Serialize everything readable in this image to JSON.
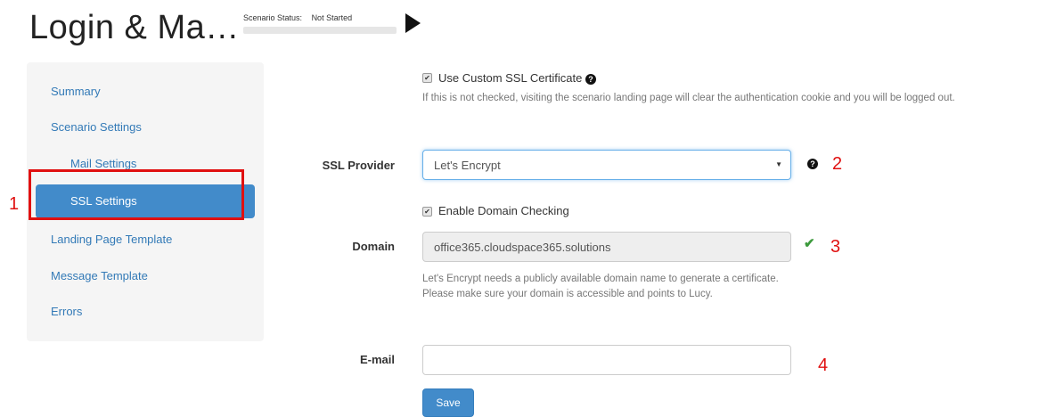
{
  "header": {
    "title": "Login & Ma…",
    "status_label": "Scenario Status:",
    "status_value": "Not Started",
    "play_icon": "play-icon"
  },
  "sidebar": {
    "items": [
      {
        "label": "Summary",
        "active": false
      },
      {
        "label": "Scenario Settings",
        "active": false
      },
      {
        "label": "Mail Settings",
        "active": false
      },
      {
        "label": "SSL Settings",
        "active": true
      },
      {
        "label": "Landing Page Template",
        "active": false
      },
      {
        "label": "Message Template",
        "active": false
      },
      {
        "label": "Errors",
        "active": false
      }
    ]
  },
  "form": {
    "custom_ssl": {
      "label": "Use Custom SSL Certificate",
      "checked": true,
      "help": "If this is not checked, visiting the scenario landing page will clear the authentication cookie and you will be logged out."
    },
    "ssl_provider": {
      "label": "SSL Provider",
      "value": "Let's Encrypt"
    },
    "domain_checking": {
      "label": "Enable Domain Checking",
      "checked": true
    },
    "domain": {
      "label": "Domain",
      "value": "office365.cloudspace365.solutions",
      "help": "Let's Encrypt needs a publicly available domain name to generate a certificate. Please make sure your domain is accessible and points to Lucy."
    },
    "email": {
      "label": "E-mail",
      "value": ""
    },
    "save_label": "Save"
  },
  "annotations": {
    "n1": "1",
    "n2": "2",
    "n3": "3",
    "n4": "4",
    "color": "#e01010"
  },
  "colors": {
    "primary": "#428bca",
    "link": "#337ab7",
    "success": "#3c9a3c"
  }
}
